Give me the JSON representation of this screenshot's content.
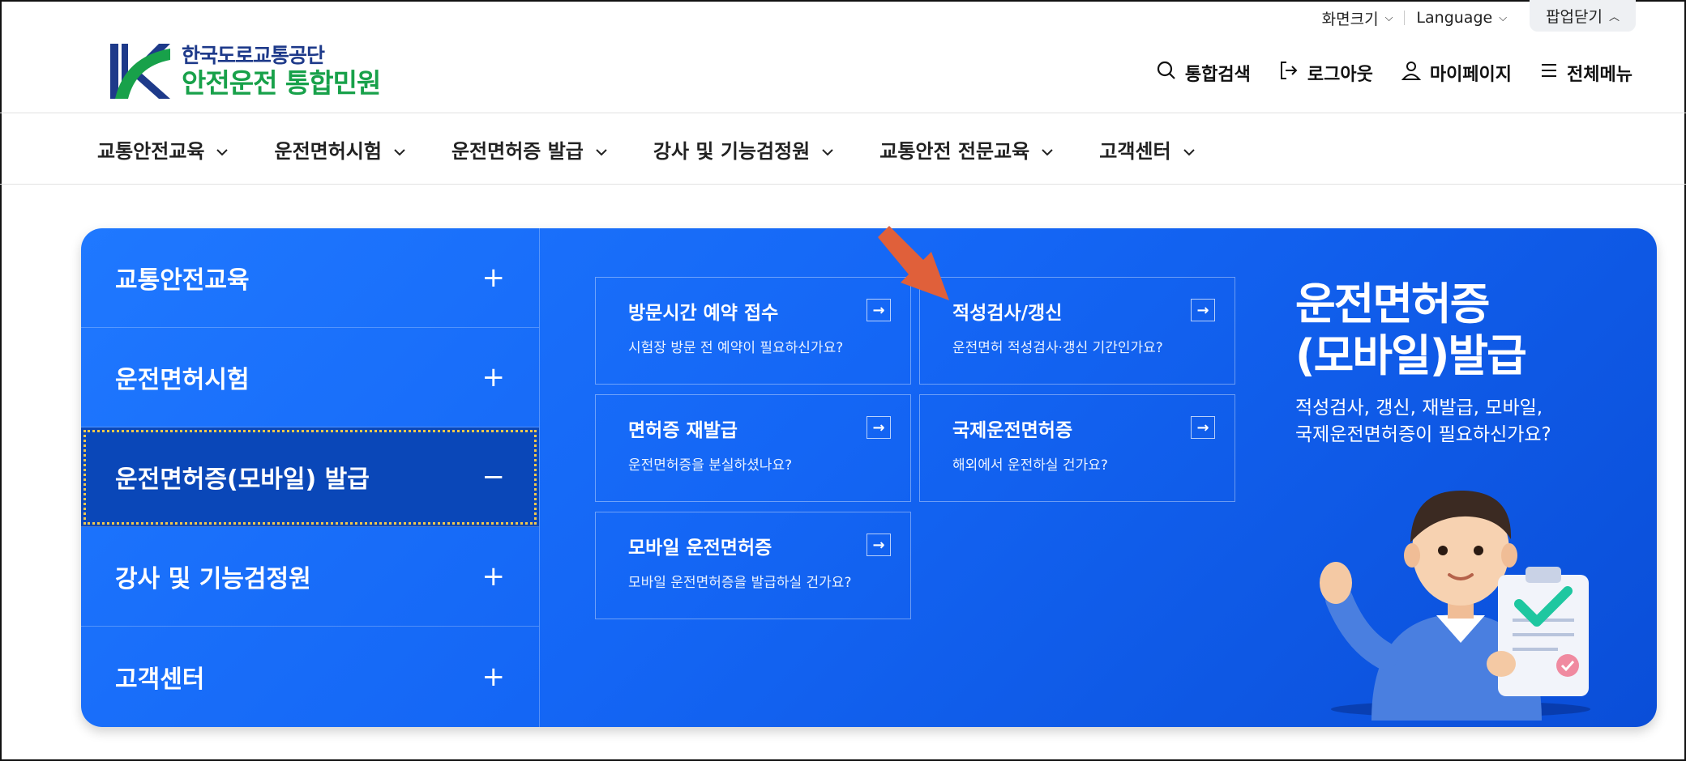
{
  "utility": {
    "screen_size": "화면크기",
    "language": "Language",
    "popup_close": "팝업닫기"
  },
  "logo": {
    "org": "한국도로교통공단",
    "title": "안전운전 통합민원"
  },
  "header_actions": {
    "search": "통합검색",
    "logout": "로그아웃",
    "mypage": "마이페이지",
    "menu": "전체메뉴"
  },
  "gnb": [
    {
      "label": "교통안전교육"
    },
    {
      "label": "운전면허시험"
    },
    {
      "label": "운전면허증 발급"
    },
    {
      "label": "강사 및 기능검정원"
    },
    {
      "label": "교통안전 전문교육"
    },
    {
      "label": "고객센터"
    }
  ],
  "side_menu": [
    {
      "label": "교통안전교육",
      "sign": "+"
    },
    {
      "label": "운전면허시험",
      "sign": "+"
    },
    {
      "label": "운전면허증(모바일) 발급",
      "sign": "−"
    },
    {
      "label": "강사 및 기능검정원",
      "sign": "+"
    },
    {
      "label": "고객센터",
      "sign": "+"
    }
  ],
  "cards": [
    {
      "title": "방문시간 예약 접수",
      "desc": "시험장 방문 전 예약이 필요하신가요?"
    },
    {
      "title": "적성검사/갱신",
      "desc": "운전면허 적성검사·갱신 기간인가요?"
    },
    {
      "title": "면허증 재발급",
      "desc": "운전면허증을 분실하셨나요?"
    },
    {
      "title": "국제운전면허증",
      "desc": "해외에서 운전하실 건가요?"
    },
    {
      "title": "모바일 운전면허증",
      "desc": "모바일 운전면허증을 발급하실 건가요?"
    }
  ],
  "promo": {
    "title_line1": "운전면허증",
    "title_line2": "(모바일)발급",
    "desc_line1": "적성검사, 갱신, 재발급, 모바일,",
    "desc_line2": "국제운전면허증이 필요하신가요?"
  },
  "colors": {
    "panel_blue": "#1466f5",
    "active_blue": "#0a47b8",
    "logo_green": "#18a14a",
    "logo_navy": "#1e3a8a",
    "annotation_arrow": "#e0603a"
  }
}
